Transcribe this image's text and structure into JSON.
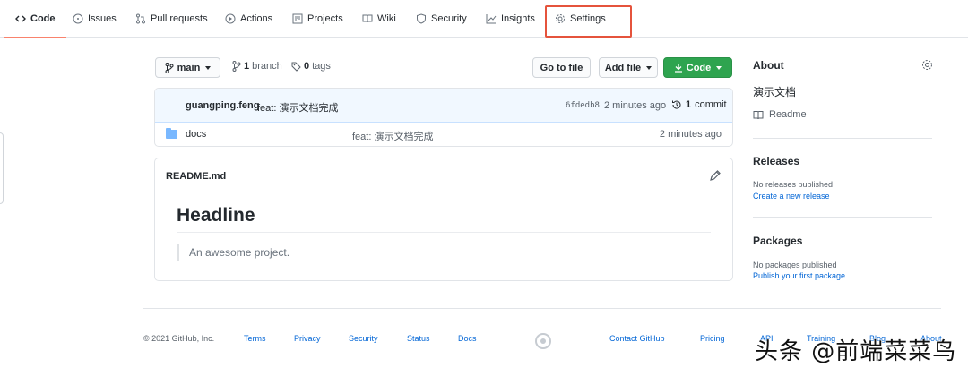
{
  "tabs": [
    {
      "label": "Code",
      "icon": "code-icon",
      "active": true
    },
    {
      "label": "Issues",
      "icon": "issue-icon"
    },
    {
      "label": "Pull requests",
      "icon": "pull-request-icon"
    },
    {
      "label": "Actions",
      "icon": "play-icon"
    },
    {
      "label": "Projects",
      "icon": "project-icon"
    },
    {
      "label": "Wiki",
      "icon": "book-icon"
    },
    {
      "label": "Security",
      "icon": "shield-icon"
    },
    {
      "label": "Insights",
      "icon": "graph-icon"
    },
    {
      "label": "Settings",
      "icon": "gear-icon"
    }
  ],
  "highlight_color": "#e5533c",
  "toolbar": {
    "branch": "main",
    "branches_count": "1",
    "branches_label": "branch",
    "tags_count": "0",
    "tags_label": "tags",
    "go_to_file": "Go to file",
    "add_file": "Add file",
    "code": "Code"
  },
  "commit": {
    "author": "guangping.feng",
    "message": "feat: 演示文档完成",
    "sha": "6fdedb8",
    "ago": "2 minutes ago",
    "count": "1",
    "count_label": "commit"
  },
  "files": [
    {
      "name": "docs",
      "message": "feat: 演示文档完成",
      "ago": "2 minutes ago"
    }
  ],
  "readme": {
    "filename": "README.md",
    "heading": "Headline",
    "quote": "An awesome project."
  },
  "about": {
    "title": "About",
    "description": "演示文档",
    "readme_link": "Readme"
  },
  "releases": {
    "title": "Releases",
    "none": "No releases published",
    "create": "Create a new release"
  },
  "packages": {
    "title": "Packages",
    "none": "No packages published",
    "publish": "Publish your first package"
  },
  "footer": {
    "copyright": "© 2021 GitHub, Inc.",
    "links": [
      "Terms",
      "Privacy",
      "Security",
      "Status",
      "Docs",
      "Contact GitHub",
      "Pricing",
      "API",
      "Training",
      "Blog",
      "About"
    ]
  },
  "watermark": "头条 @前端菜菜鸟"
}
